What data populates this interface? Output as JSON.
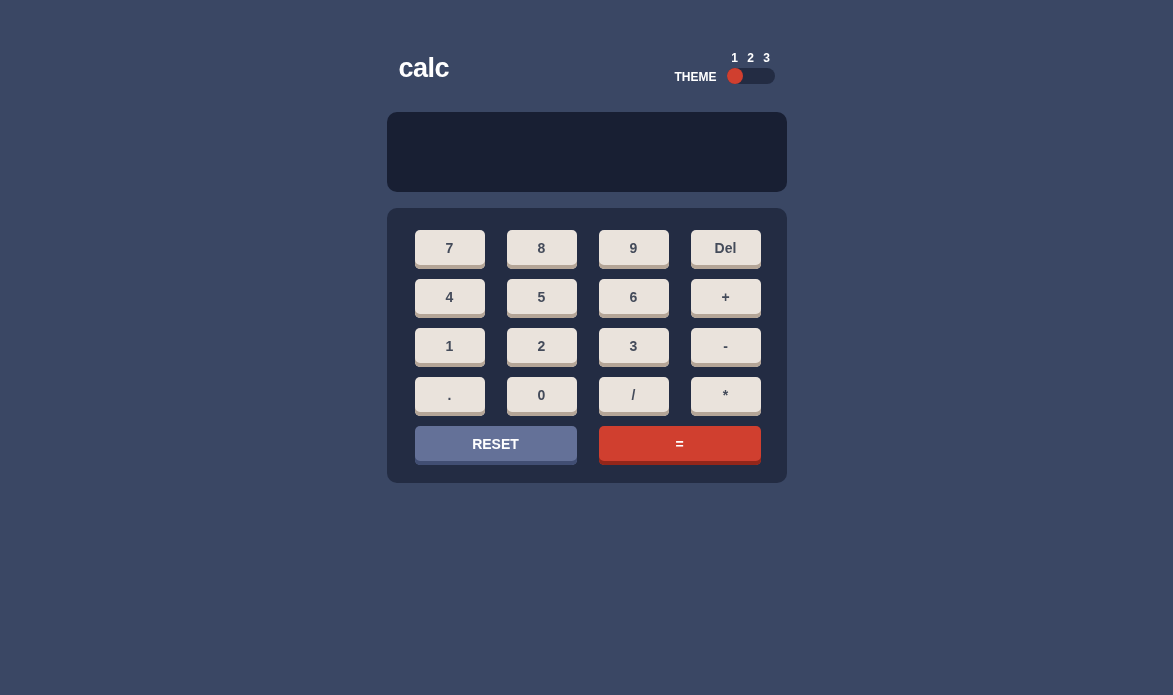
{
  "app": {
    "title": "calc"
  },
  "theme": {
    "label": "THEME",
    "options": [
      {
        "label": "1",
        "selected": true
      },
      {
        "label": "2",
        "selected": false
      },
      {
        "label": "3",
        "selected": false
      }
    ]
  },
  "keys": [
    {
      "label": "7",
      "kind": "key"
    },
    {
      "label": "8",
      "kind": "key"
    },
    {
      "label": "9",
      "kind": "key"
    },
    {
      "label": "Del",
      "kind": "key"
    },
    {
      "label": "4",
      "kind": "key"
    },
    {
      "label": "5",
      "kind": "key"
    },
    {
      "label": "6",
      "kind": "key"
    },
    {
      "label": "+",
      "kind": "key"
    },
    {
      "label": "1",
      "kind": "key"
    },
    {
      "label": "2",
      "kind": "key"
    },
    {
      "label": "3",
      "kind": "key"
    },
    {
      "label": "-",
      "kind": "key"
    },
    {
      "label": ".",
      "kind": "key"
    },
    {
      "label": "0",
      "kind": "key"
    },
    {
      "label": "/",
      "kind": "key"
    },
    {
      "label": "*",
      "kind": "key"
    },
    {
      "label": "RESET",
      "kind": "reset"
    },
    {
      "label": "=",
      "kind": "equals"
    }
  ]
}
